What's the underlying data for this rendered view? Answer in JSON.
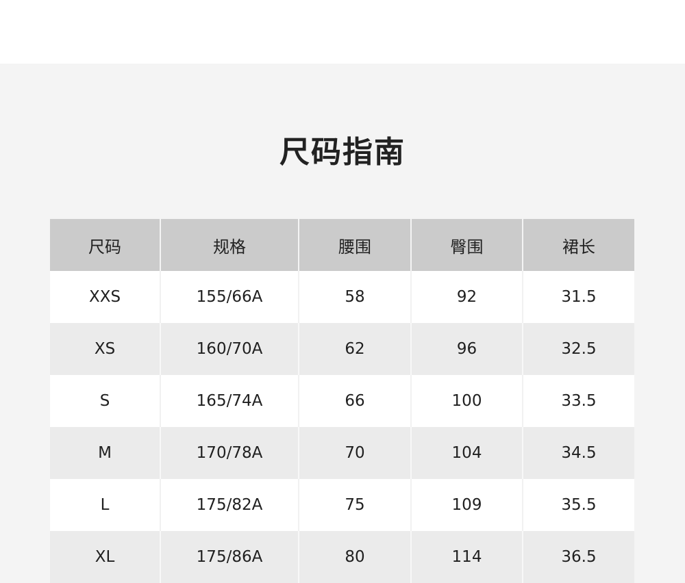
{
  "title": "尺码指南",
  "table": {
    "headers": [
      "尺码",
      "规格",
      "腰围",
      "臀围",
      "裙长"
    ],
    "rows": [
      [
        "XXS",
        "155/66A",
        "58",
        "92",
        "31.5"
      ],
      [
        "XS",
        "160/70A",
        "62",
        "96",
        "32.5"
      ],
      [
        "S",
        "165/74A",
        "66",
        "100",
        "33.5"
      ],
      [
        "M",
        "170/78A",
        "70",
        "104",
        "34.5"
      ],
      [
        "L",
        "175/82A",
        "75",
        "109",
        "35.5"
      ],
      [
        "XL",
        "175/86A",
        "80",
        "114",
        "36.5"
      ]
    ]
  },
  "colors": {
    "background": "#f4f4f4",
    "header_bg": "#cbcbcb",
    "row_white": "#ffffff",
    "row_gray": "#ebebeb",
    "text": "#1f1f1f"
  }
}
